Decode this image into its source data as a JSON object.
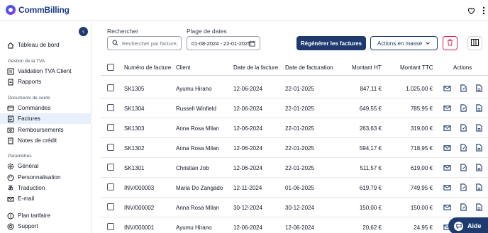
{
  "brand": {
    "name": "CommBilling"
  },
  "sidebar": {
    "top_item": {
      "label": "Tableau de bord",
      "icon": "home-icon"
    },
    "sections": [
      {
        "title": "Gestion de la TVA",
        "items": [
          {
            "label": "Validation TVA Client",
            "icon": "checklist-icon"
          },
          {
            "label": "Rapports",
            "icon": "report-icon"
          }
        ]
      },
      {
        "title": "Documents de vente",
        "items": [
          {
            "label": "Commandes",
            "icon": "cart-icon"
          },
          {
            "label": "Factures",
            "icon": "invoice-icon",
            "active": true
          },
          {
            "label": "Remboursements",
            "icon": "refund-icon"
          },
          {
            "label": "Notes de crédit",
            "icon": "credit-note-icon"
          }
        ]
      },
      {
        "title": "Paramètres",
        "items": [
          {
            "label": "Général",
            "icon": "gear-icon"
          },
          {
            "label": "Personnalisation",
            "icon": "palette-icon"
          },
          {
            "label": "Traduction",
            "icon": "translate-icon"
          },
          {
            "label": "E-mail",
            "icon": "mail-icon"
          }
        ]
      }
    ],
    "bottom_items": [
      {
        "label": "Plan tarifaire",
        "icon": "pricing-icon"
      },
      {
        "label": "Support",
        "icon": "support-icon"
      }
    ]
  },
  "filters": {
    "search_label": "Rechercher",
    "search_placeholder": "Rechercher par facture, c",
    "date_label": "Plage de dates",
    "date_value": "01-08-2024 - 22-01-2025"
  },
  "toolbar": {
    "regenerate_label": "Régénérer les factures",
    "bulk_label": "Actions en masse"
  },
  "table": {
    "headers": [
      "Numéro de facture",
      "Client",
      "Date de la facture",
      "Date de facturation",
      "Montant HT",
      "Montant TTC",
      "Actions"
    ],
    "rows": [
      [
        "SK1305",
        "Ayumu Hirano",
        "12-06-2024",
        "22-01-2025",
        "847,11 €",
        "1.025,00 €"
      ],
      [
        "SK1304",
        "Russell Winfield",
        "12-06-2024",
        "22-01-2025",
        "649,55 €",
        "785,95 €"
      ],
      [
        "SK1303",
        "Anna Rosa Milan",
        "12-06-2024",
        "22-01-2025",
        "263,63 €",
        "319,00 €"
      ],
      [
        "SK1302",
        "Anna Rosa Milan",
        "12-06-2024",
        "22-01-2025",
        "594,17 €",
        "718,95 €"
      ],
      [
        "SK1301",
        "Christian Job",
        "12-06-2024",
        "22-01-2025",
        "511,57 €",
        "619,00 €"
      ],
      [
        "INV/000003",
        "Maria Do Zangado",
        "12-11-2024",
        "01-06-2025",
        "619,79 €",
        "749,95 €"
      ],
      [
        "INV/000002",
        "Anna Rosa Milan",
        "30-12-2024",
        "30-12-2024",
        "150,00 €",
        "150,00 €"
      ],
      [
        "INV/000001",
        "Ayumu Hirano",
        "12-06-2024",
        "12-06-2024",
        "20,62 €",
        "24,95 €"
      ]
    ]
  },
  "help": {
    "label": "Aide"
  },
  "colors": {
    "primary": "#1e3a6e",
    "danger": "#e11d48",
    "active_bg": "#e8f0fb"
  }
}
